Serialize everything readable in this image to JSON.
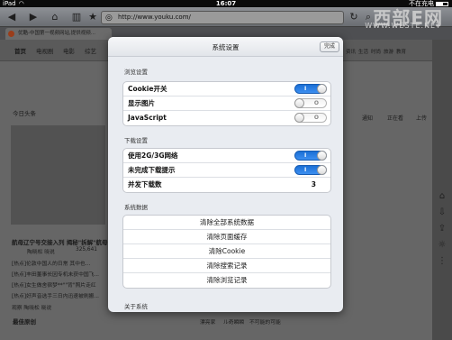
{
  "status_bar": {
    "carrier": "iPad",
    "time": "16:07",
    "right_text": "不在充电"
  },
  "browser": {
    "url": "http://www.youku.com/",
    "tab_title": "优酷-中国第一视频网站,提供视频..."
  },
  "watermark": {
    "logo": "西部E网",
    "url": "WWW.WESTE.NET"
  },
  "page": {
    "nav": [
      "首页",
      "电视剧",
      "电影",
      "综艺"
    ],
    "nav_right": [
      "资讯",
      "生活",
      "时尚",
      "旅游",
      "教育"
    ],
    "nav_sub": [
      "通知",
      "正在看",
      "上传"
    ],
    "section_today": "今日头条",
    "headline": "航母辽宁号交接入列 揭秘\"拆解\"航母",
    "meta": [
      "陶晓松 晓说",
      "325,641"
    ],
    "news": [
      "[热点]伦敦中国人的日常 其中也...",
      "[热点]丰田董事长因专机未获中国飞...",
      "[热点]女生做舍宿梦**\"\"背\"照片走红",
      "[热点]好声音选手三日内迅速被刷搬..."
    ],
    "footer_meta": "观察 陶晓松 晓说",
    "section_original": "最佳原创",
    "original_tags": [
      "漂亮家",
      "ル奇瞬瞬",
      "不可能的可能"
    ]
  },
  "settings": {
    "title": "系统设置",
    "done_label": "完成",
    "browse": {
      "title": "浏览设置",
      "rows": [
        {
          "label": "Cookie开关",
          "state": "on"
        },
        {
          "label": "显示图片",
          "state": "off"
        },
        {
          "label": "JavaScript",
          "state": "off"
        }
      ]
    },
    "download": {
      "title": "下载设置",
      "rows": [
        {
          "label": "使用2G/3G网络",
          "state": "on"
        },
        {
          "label": "未完成下载提示",
          "state": "on"
        }
      ],
      "concurrent_label": "并发下载数",
      "concurrent_value": "3"
    },
    "system_data": {
      "title": "系统数据",
      "actions": [
        "清除全部系统数据",
        "清除页面缓存",
        "清除Cookie",
        "清除搜索记录",
        "清除浏览记录"
      ]
    },
    "about_title": "关于系统"
  },
  "toggle_marks": {
    "on": "I",
    "off": "O"
  }
}
